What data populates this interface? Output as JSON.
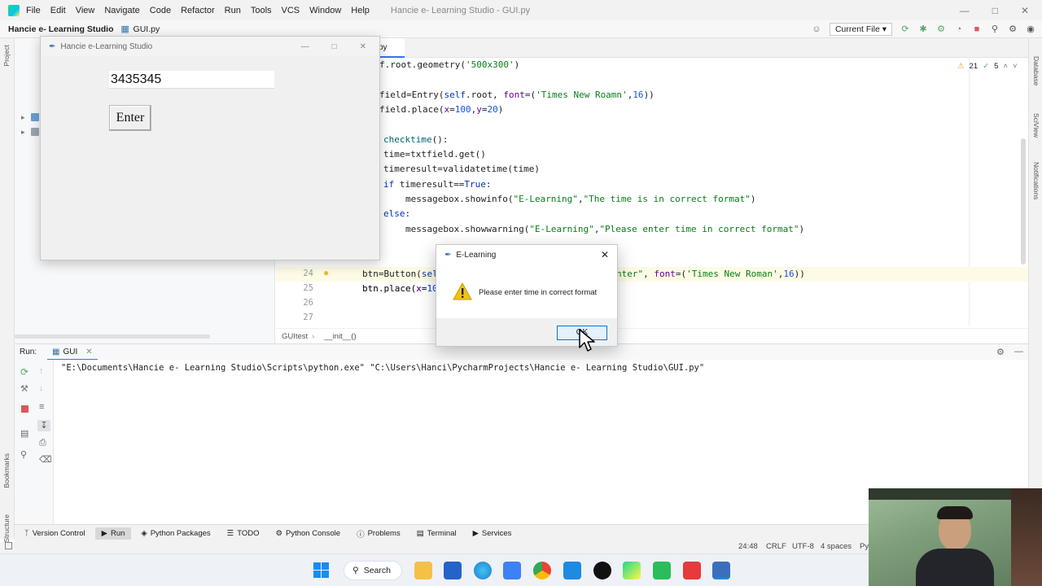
{
  "menubar": {
    "items": [
      "File",
      "Edit",
      "View",
      "Navigate",
      "Code",
      "Refactor",
      "Run",
      "Tools",
      "VCS",
      "Window",
      "Help"
    ],
    "title": "Hancie e- Learning Studio - GUI.py"
  },
  "navbar": {
    "project": "Hancie e- Learning Studio",
    "file": "GUI.py",
    "run_config": "Current File"
  },
  "left_strip": {
    "project": "Project",
    "bookmarks": "Bookmarks",
    "structure": "Structure"
  },
  "right_strip": {
    "database": "Database",
    "sciview": "SciView",
    "notifications": "Notifications"
  },
  "editor": {
    "tab_label": "py",
    "inspections": {
      "warnings": "21",
      "ok": "5"
    },
    "gutter": [
      "24",
      "25",
      "26",
      "27"
    ],
    "breadcrumb": [
      "GUItest",
      "__init__()"
    ]
  },
  "run_panel": {
    "label": "Run:",
    "config": "GUI",
    "command": "\"E:\\Documents\\Hancie e- Learning Studio\\Scripts\\python.exe\" \"C:\\Users\\Hanci\\PycharmProjects\\Hancie e- Learning Studio\\GUI.py\""
  },
  "tool_windows": [
    "Version Control",
    "Run",
    "Python Packages",
    "TODO",
    "Python Console",
    "Problems",
    "Terminal",
    "Services"
  ],
  "status_bar": {
    "position": "24:48",
    "line_sep": "CRLF",
    "encoding": "UTF-8",
    "indent": "4 spaces",
    "interpreter": "Py"
  },
  "tk_window": {
    "title": "Hancie e-Learning Studio",
    "entry_value": "3435345",
    "button": "Enter"
  },
  "message_box": {
    "title": "E-Learning",
    "message": "Please enter time in correct format",
    "ok": "OK"
  },
  "taskbar": {
    "search": "Search"
  },
  "colors": {
    "accent": "#0078d7",
    "warning": "#f5c211",
    "keyword": "#0033b3",
    "string": "#067d17"
  }
}
